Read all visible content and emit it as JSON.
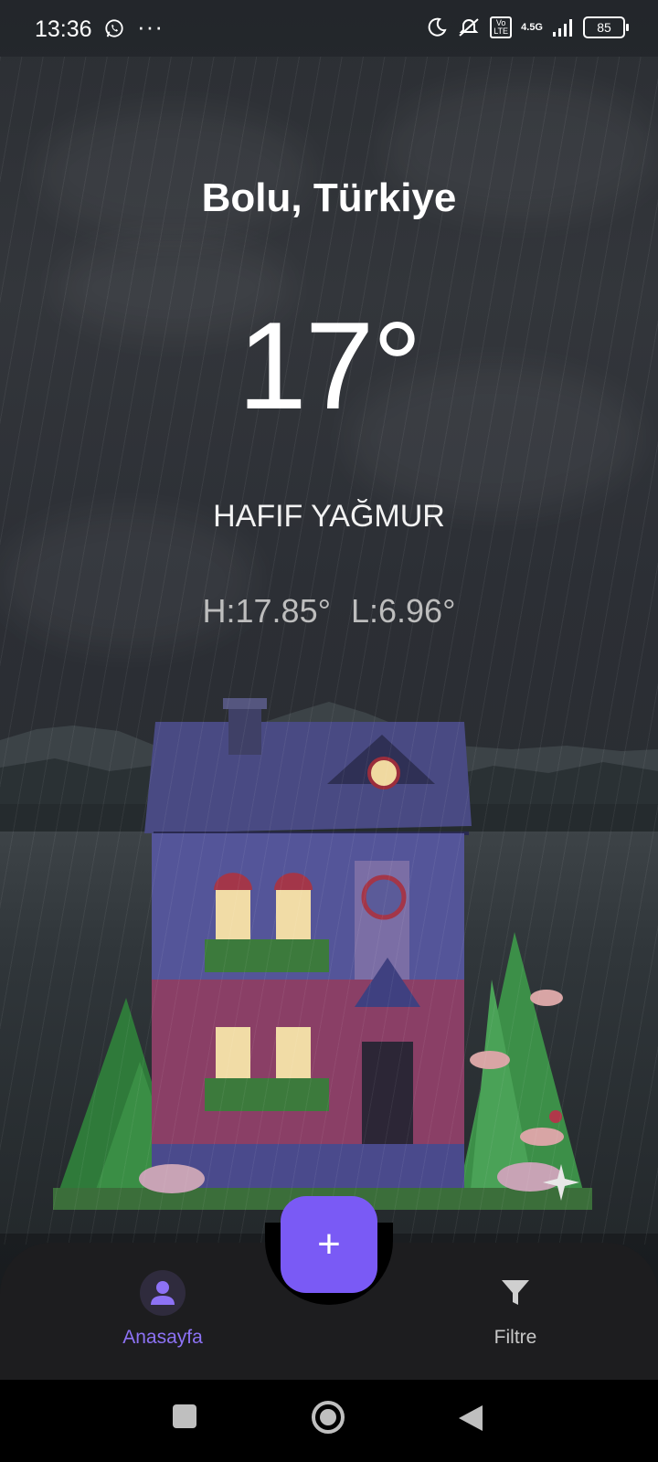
{
  "status_bar": {
    "time": "13:36",
    "more": "···",
    "network": "4.5G",
    "volte": "Vo LTE",
    "battery": "85"
  },
  "weather": {
    "city": "Bolu, Türkiye",
    "temperature": "17°",
    "condition": "HAFIF YAĞMUR",
    "high": "H:17.85°",
    "low": "L:6.96°"
  },
  "bottom_nav": {
    "home_label": "Anasayfa",
    "add_label": "+",
    "filter_label": "Filtre"
  },
  "colors": {
    "accent": "#7a5af5",
    "nav_background": "#1d1d1f"
  },
  "icons": {
    "home": "person-icon",
    "filter": "funnel-icon",
    "add": "plus-icon",
    "recent_apps": "square-icon",
    "home_system": "circle-icon",
    "back": "triangle-back-icon"
  }
}
